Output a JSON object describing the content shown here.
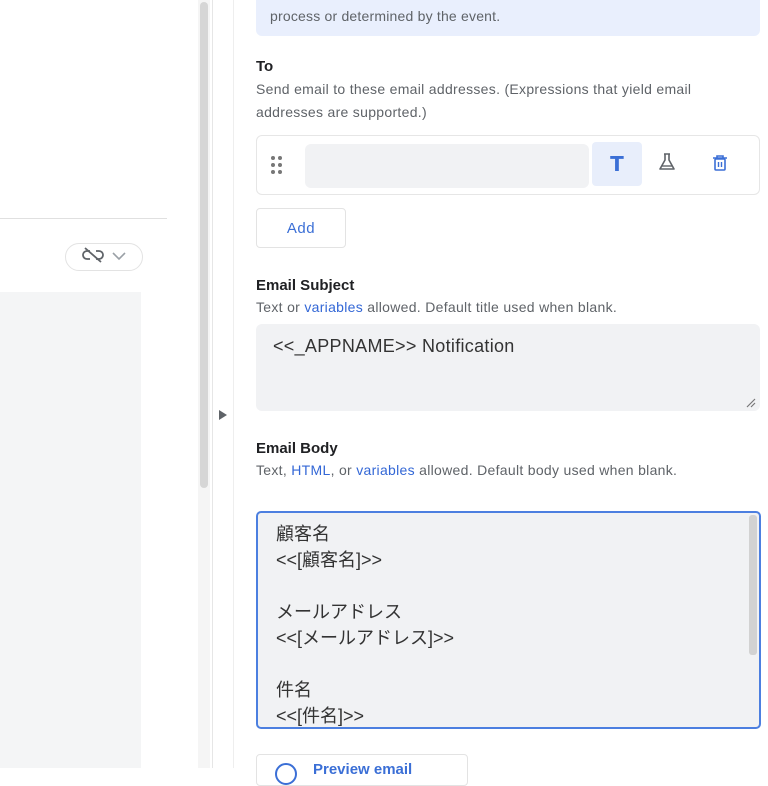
{
  "info_box": {
    "text": "process or determined by the event."
  },
  "to_section": {
    "title": "To",
    "description": "Send email to these email addresses. (Expressions that yield email addresses are supported.)",
    "input_value": "",
    "text_mode_label": "T",
    "add_label": "Add"
  },
  "subject_section": {
    "title": "Email Subject",
    "desc_prefix": "Text or ",
    "desc_link": "variables",
    "desc_suffix": " allowed. Default title used when blank.",
    "value": "<<_APPNAME>> Notification"
  },
  "body_section": {
    "title": "Email Body",
    "desc_prefix": "Text, ",
    "desc_link_html": "HTML",
    "desc_mid": ", or ",
    "desc_link_vars": "variables",
    "desc_suffix": " allowed. Default body used when blank.",
    "lines": [
      "顧客名",
      "<<[顧客名]>>",
      "",
      "メールアドレス",
      "<<[メールアドレス]>>",
      "",
      "件名",
      "<<[件名]>>"
    ]
  },
  "preview": {
    "label": "Preview email"
  },
  "colors": {
    "accent": "#3b6fd6",
    "link": "#3367d6",
    "info_bg": "#e9effd",
    "field_bg": "#f1f2f4",
    "focus_border": "#4c7fe0"
  },
  "icons": [
    "unlink-icon",
    "chevron-down-icon",
    "collapse-arrow-icon",
    "drag-handle-icon",
    "flask-icon",
    "trash-icon",
    "preview-icon",
    "resize-grip-icon"
  ]
}
